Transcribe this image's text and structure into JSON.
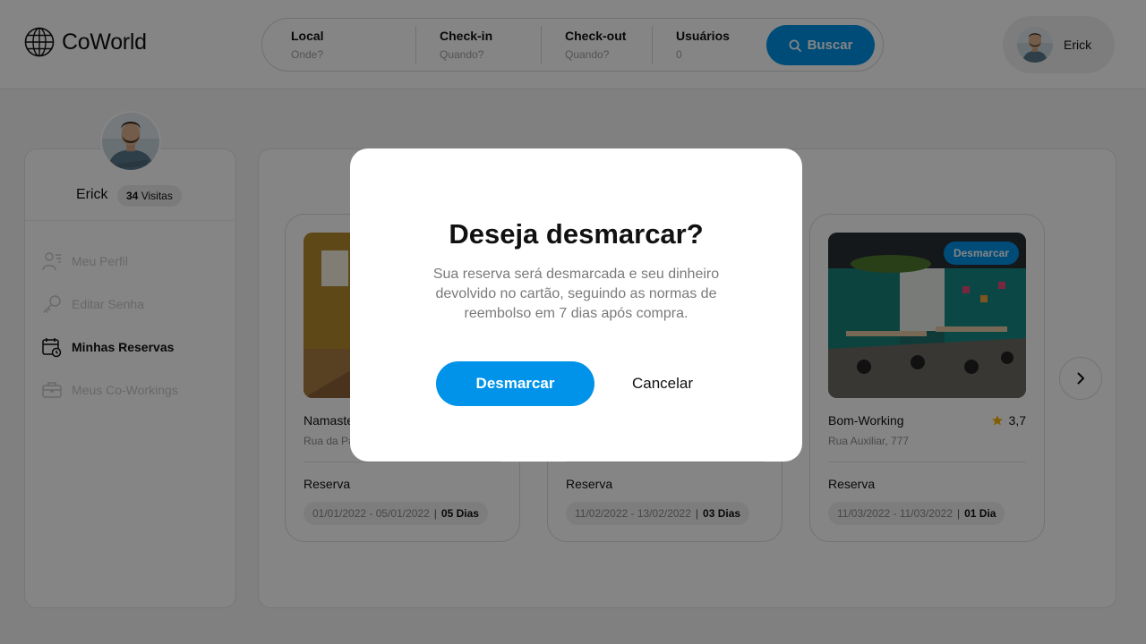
{
  "app": {
    "logo_text": "CoWorld"
  },
  "search": {
    "fields": [
      {
        "label": "Local",
        "placeholder": "Onde?"
      },
      {
        "label": "Check-in",
        "placeholder": "Quando?"
      },
      {
        "label": "Check-out",
        "placeholder": "Quando?"
      },
      {
        "label": "Usuários",
        "placeholder": "0"
      }
    ],
    "button_label": "Buscar",
    "button_icon": "search-icon"
  },
  "user": {
    "name": "Erick"
  },
  "profile": {
    "name": "Erick",
    "visits_count": "34",
    "visits_label": "Visitas"
  },
  "menu": [
    {
      "label": "Meu Perfil",
      "icon": "user-list-icon",
      "active": false
    },
    {
      "label": "Editar Senha",
      "icon": "key-icon",
      "active": false
    },
    {
      "label": "Minhas Reservas",
      "icon": "calendar-clock-icon",
      "active": true
    },
    {
      "label": "Meus Co-Workings",
      "icon": "briefcase-icon",
      "active": false
    }
  ],
  "reservations": [
    {
      "name": "Namaste",
      "address": "Rua da Paz",
      "reserva_label": "Reserva",
      "dates": "01/01/2022 - 05/01/2022",
      "duration": "05 Dias"
    },
    {
      "name": "",
      "address": "",
      "reserva_label": "Reserva",
      "dates": "11/02/2022 - 13/02/2022",
      "duration": "03 Dias"
    },
    {
      "name": "Bom-Working",
      "address": "Rua Auxiliar, 777",
      "rating": "3,7",
      "badge": "Desmarcar",
      "reserva_label": "Reserva",
      "dates": "11/03/2022 - 11/03/2022",
      "duration": "01 Dia"
    }
  ],
  "modal": {
    "title": "Deseja desmarcar?",
    "text": "Sua reserva será desmarcada e seu dinheiro devolvido no cartão, seguindo as normas de reembolso em 7 dias após compra.",
    "confirm_label": "Desmarcar",
    "cancel_label": "Cancelar"
  },
  "colors": {
    "accent": "#0093e9",
    "star": "#f5b300",
    "overlay": "rgba(0,0,0,0.48)"
  }
}
